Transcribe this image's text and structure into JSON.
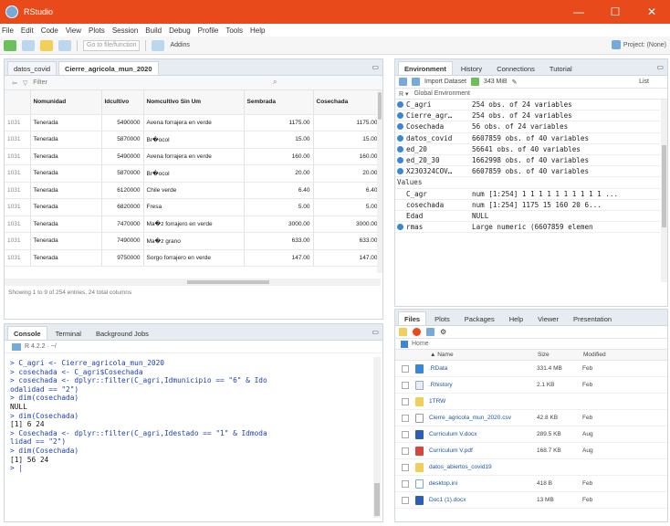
{
  "window": {
    "title": "RStudio",
    "controls": [
      "—",
      "☐",
      "✕"
    ],
    "accent": "#e84a1c"
  },
  "menu": [
    "File",
    "Edit",
    "Code",
    "View",
    "Plots",
    "Session",
    "Build",
    "Debug",
    "Profile",
    "Tools",
    "Help"
  ],
  "toolbar": {
    "goto_placeholder": "Go to file/function",
    "addins": "Addins",
    "project": "Project: (None)"
  },
  "source": {
    "tabs": [
      "datos_covid",
      "Cierre_agricola_mun_2020"
    ],
    "filter_label": "Filter",
    "columns": [
      "Nomunidad",
      "Idcultivo",
      "Nomcultivo Sin Um",
      "Sembrada",
      "Cosechada"
    ],
    "rows": [
      {
        "n": "1031",
        "mun": "Tenerada",
        "id": "5490000",
        "cult": "Avena forrajera en verde",
        "sem": "1175.00",
        "cos": "1175.00"
      },
      {
        "n": "1031",
        "mun": "Tenerada",
        "id": "5870000",
        "cult": "Br�ocol",
        "sem": "15.00",
        "cos": "15.00"
      },
      {
        "n": "1031",
        "mun": "Tenerada",
        "id": "5490000",
        "cult": "Avena forrajera en verde",
        "sem": "160.00",
        "cos": "160.00"
      },
      {
        "n": "1031",
        "mun": "Tenerada",
        "id": "5870000",
        "cult": "Br�ocol",
        "sem": "20.00",
        "cos": "20.00"
      },
      {
        "n": "1031",
        "mun": "Tenerada",
        "id": "6120000",
        "cult": "Chile verde",
        "sem": "6.40",
        "cos": "6.40"
      },
      {
        "n": "1031",
        "mun": "Tenerada",
        "id": "6820000",
        "cult": "Fresa",
        "sem": "5.00",
        "cos": "5.00"
      },
      {
        "n": "1031",
        "mun": "Tenerada",
        "id": "7470000",
        "cult": "Ma�z forrajero en verde",
        "sem": "3000.00",
        "cos": "3000.00"
      },
      {
        "n": "1031",
        "mun": "Tenerada",
        "id": "7490000",
        "cult": "Ma�z grano",
        "sem": "633.00",
        "cos": "633.00"
      },
      {
        "n": "1031",
        "mun": "Tenerada",
        "id": "9750000",
        "cult": "Sorgo forrajero en verde",
        "sem": "147.00",
        "cos": "147.00"
      }
    ],
    "status": "Showing 1 to 9 of 254 entries, 24 total columns"
  },
  "console": {
    "tabs": [
      "Console",
      "Terminal",
      "Background Jobs"
    ],
    "version": "R 4.2.2 · ~/",
    "lines": [
      {
        "t": "in",
        "text": "> C_agri <- Cierre_agricola_mun_2020"
      },
      {
        "t": "in",
        "text": "> cosechada <- C_agri$Cosechada"
      },
      {
        "t": "in",
        "text": "> cosechada <- dplyr::filter(C_agri,Idmunicipio == \"6\" & Ido"
      },
      {
        "t": "in",
        "text": "odalidad == \"2\")"
      },
      {
        "t": "in",
        "text": "> dim(cosechada)"
      },
      {
        "t": "out",
        "text": "NULL"
      },
      {
        "t": "in",
        "text": "> dim(Cosechada)"
      },
      {
        "t": "out",
        "text": "[1]  6 24"
      },
      {
        "t": "in",
        "text": "> Cosechada <- dplyr::filter(C_agri,Idestado == \"1\" & Idmoda"
      },
      {
        "t": "in",
        "text": "lidad == \"2\")"
      },
      {
        "t": "in",
        "text": "> dim(Cosechada)"
      },
      {
        "t": "out",
        "text": "[1] 56 24"
      },
      {
        "t": "in",
        "text": "> |"
      }
    ]
  },
  "environment": {
    "tabs": [
      "Environment",
      "History",
      "Connections",
      "Tutorial"
    ],
    "tools": [
      "Import Dataset",
      "343 MiB",
      "List"
    ],
    "scope": "Global Environment",
    "data": [
      {
        "name": "C_agri",
        "value": "254 obs. of 24 variables"
      },
      {
        "name": "Cierre_agr…",
        "value": "254 obs. of 24 variables"
      },
      {
        "name": "Cosechada",
        "value": "56 obs. of 24 variables"
      },
      {
        "name": "datos_covid",
        "value": "6607859 obs. of 40 variables"
      },
      {
        "name": "ed_20",
        "value": "56641 obs. of 40 variables"
      },
      {
        "name": "ed_20_30",
        "value": "1662998 obs. of 40 variables"
      },
      {
        "name": "X230324COV…",
        "value": "6607859 obs. of 40 variables"
      }
    ],
    "values_header": "Values",
    "values": [
      {
        "name": "C_agr",
        "value": "num [1:254] 1 1 1 1 1 1 1 1 1 1 ..."
      },
      {
        "name": "cosechada",
        "value": "num [1:254] 1175 15 160 20 6..."
      },
      {
        "name": "Edad",
        "value": "NULL"
      },
      {
        "name": "rmas",
        "value": "Large numeric (6607859 elemen"
      }
    ]
  },
  "files": {
    "tabs": [
      "Files",
      "Plots",
      "Packages",
      "Help",
      "Viewer",
      "Presentation"
    ],
    "path": "Home",
    "columns": [
      "▲ Name",
      "Size",
      "Modified"
    ],
    "items": [
      {
        "icon": "data",
        "name": ".RData",
        "size": "331.4 MB",
        "mod": "Feb"
      },
      {
        "icon": "hist",
        "name": ".Rhistory",
        "size": "2.1 KB",
        "mod": "Feb"
      },
      {
        "icon": "folder",
        "name": "1TRW",
        "size": "",
        "mod": ""
      },
      {
        "icon": "csv",
        "name": "Cierre_agricola_mun_2020.csv",
        "size": "42.8 KB",
        "mod": "Feb"
      },
      {
        "icon": "doc",
        "name": "Curriculum V.docx",
        "size": "289.5 KB",
        "mod": "Aug"
      },
      {
        "icon": "pdf",
        "name": "Curriculum V.pdf",
        "size": "168.7 KB",
        "mod": "Aug"
      },
      {
        "icon": "folder",
        "name": "datos_abiertos_covid19",
        "size": "",
        "mod": ""
      },
      {
        "icon": "rfile",
        "name": "desktop.ini",
        "size": "418 B",
        "mod": "Feb"
      },
      {
        "icon": "doc",
        "name": "Doc1 (1).docx",
        "size": "13 MB",
        "mod": "Feb"
      }
    ]
  }
}
